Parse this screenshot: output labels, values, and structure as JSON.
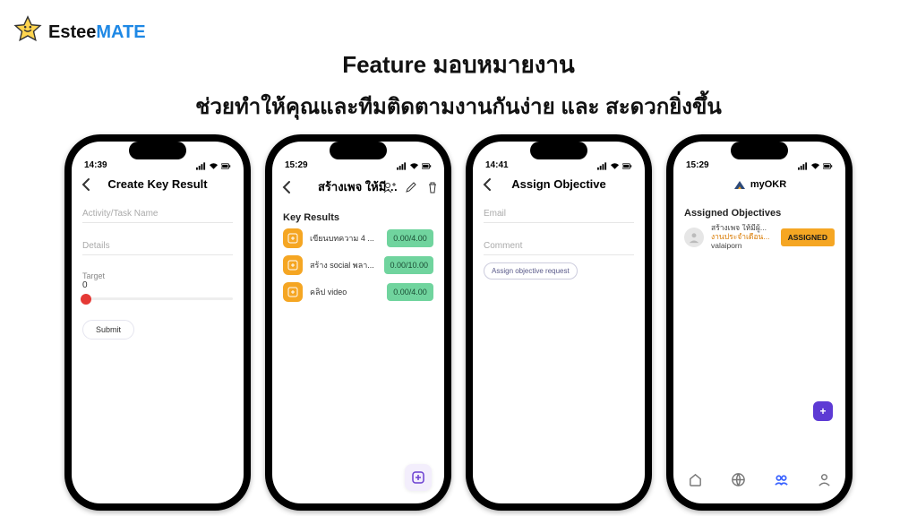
{
  "brand": {
    "part1": "Estee",
    "part2": "MATE"
  },
  "heading": {
    "line1": "Feature มอบหมายงาน",
    "line2": "ช่วยทำให้คุณและทีมติดตามงานกันง่าย และ สะดวกยิ่งขึ้น"
  },
  "phone1": {
    "time": "14:39",
    "title": "Create Key Result",
    "activity_placeholder": "Activity/Task Name",
    "details_placeholder": "Details",
    "target_label": "Target",
    "target_value": "0",
    "submit_label": "Submit"
  },
  "phone2": {
    "time": "15:29",
    "title": "สร้างเพจ ให้มีผู้ติ...",
    "section": "Key Results",
    "items": [
      {
        "label": "เขียนบทความ 4 ...",
        "badge": "0.00/4.00"
      },
      {
        "label": "สร้าง social พลา...",
        "badge": "0.00/10.00"
      },
      {
        "label": "คลิป video",
        "badge": "0.00/4.00"
      }
    ]
  },
  "phone3": {
    "time": "14:41",
    "title": "Assign Objective",
    "email_label": "Email",
    "comment_label": "Comment",
    "chip_label": "Assign objective request"
  },
  "phone4": {
    "time": "15:29",
    "app_title": "myOKR",
    "section": "Assigned Objectives",
    "item": {
      "line1": "สร้างเพจ ให้มีผู้...",
      "line2": "งานประจำเดือน...",
      "line3": "valaiporn",
      "badge": "ASSIGNED"
    }
  }
}
